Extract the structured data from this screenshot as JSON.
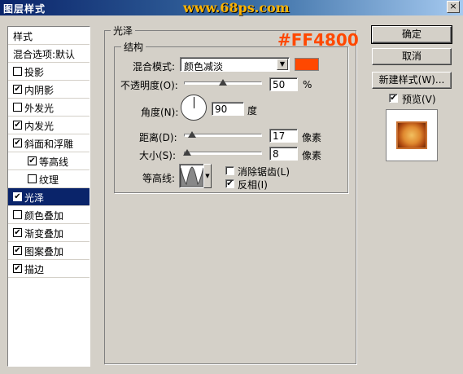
{
  "window": {
    "title": "图层样式",
    "watermark": "www.68ps.com",
    "close_glyph": "×"
  },
  "annotation": {
    "color_text": "#FF4800"
  },
  "left_list": {
    "header": "样式",
    "items": [
      {
        "label": "混合选项:默认",
        "checkbox": false,
        "checked": false,
        "selected": false,
        "indent": false
      },
      {
        "label": "投影",
        "checkbox": true,
        "checked": false,
        "selected": false,
        "indent": false
      },
      {
        "label": "内阴影",
        "checkbox": true,
        "checked": true,
        "selected": false,
        "indent": false
      },
      {
        "label": "外发光",
        "checkbox": true,
        "checked": false,
        "selected": false,
        "indent": false
      },
      {
        "label": "内发光",
        "checkbox": true,
        "checked": true,
        "selected": false,
        "indent": false
      },
      {
        "label": "斜面和浮雕",
        "checkbox": true,
        "checked": true,
        "selected": false,
        "indent": false
      },
      {
        "label": "等高线",
        "checkbox": true,
        "checked": true,
        "selected": false,
        "indent": true
      },
      {
        "label": "纹理",
        "checkbox": true,
        "checked": false,
        "selected": false,
        "indent": true
      },
      {
        "label": "光泽",
        "checkbox": true,
        "checked": true,
        "selected": true,
        "indent": false
      },
      {
        "label": "颜色叠加",
        "checkbox": true,
        "checked": false,
        "selected": false,
        "indent": false
      },
      {
        "label": "渐变叠加",
        "checkbox": true,
        "checked": true,
        "selected": false,
        "indent": false
      },
      {
        "label": "图案叠加",
        "checkbox": true,
        "checked": true,
        "selected": false,
        "indent": false
      },
      {
        "label": "描边",
        "checkbox": true,
        "checked": true,
        "selected": false,
        "indent": false
      }
    ]
  },
  "satin": {
    "group_title": "光泽",
    "structure_title": "结构",
    "blend_mode_label": "混合模式:",
    "blend_mode_value": "颜色减淡",
    "color": "#ff4800",
    "opacity_label": "不透明度(O):",
    "opacity_value": "50",
    "opacity_unit": "%",
    "opacity_fraction": 0.5,
    "angle_label": "角度(N):",
    "angle_value": "90",
    "angle_unit": "度",
    "distance_label": "距离(D):",
    "distance_value": "17",
    "distance_unit": "像素",
    "distance_fraction": 0.1,
    "size_label": "大小(S):",
    "size_value": "8",
    "size_unit": "像素",
    "size_fraction": 0.04,
    "contour_label": "等高线:",
    "anti_alias_label": "消除锯齿(L)",
    "anti_alias_checked": false,
    "invert_label": "反相(I)",
    "invert_checked": true
  },
  "buttons": {
    "ok": "确定",
    "cancel": "取消",
    "new_style": "新建样式(W)...",
    "preview_label": "预览(V)",
    "preview_checked": true
  },
  "checkmark_glyph": "✔"
}
